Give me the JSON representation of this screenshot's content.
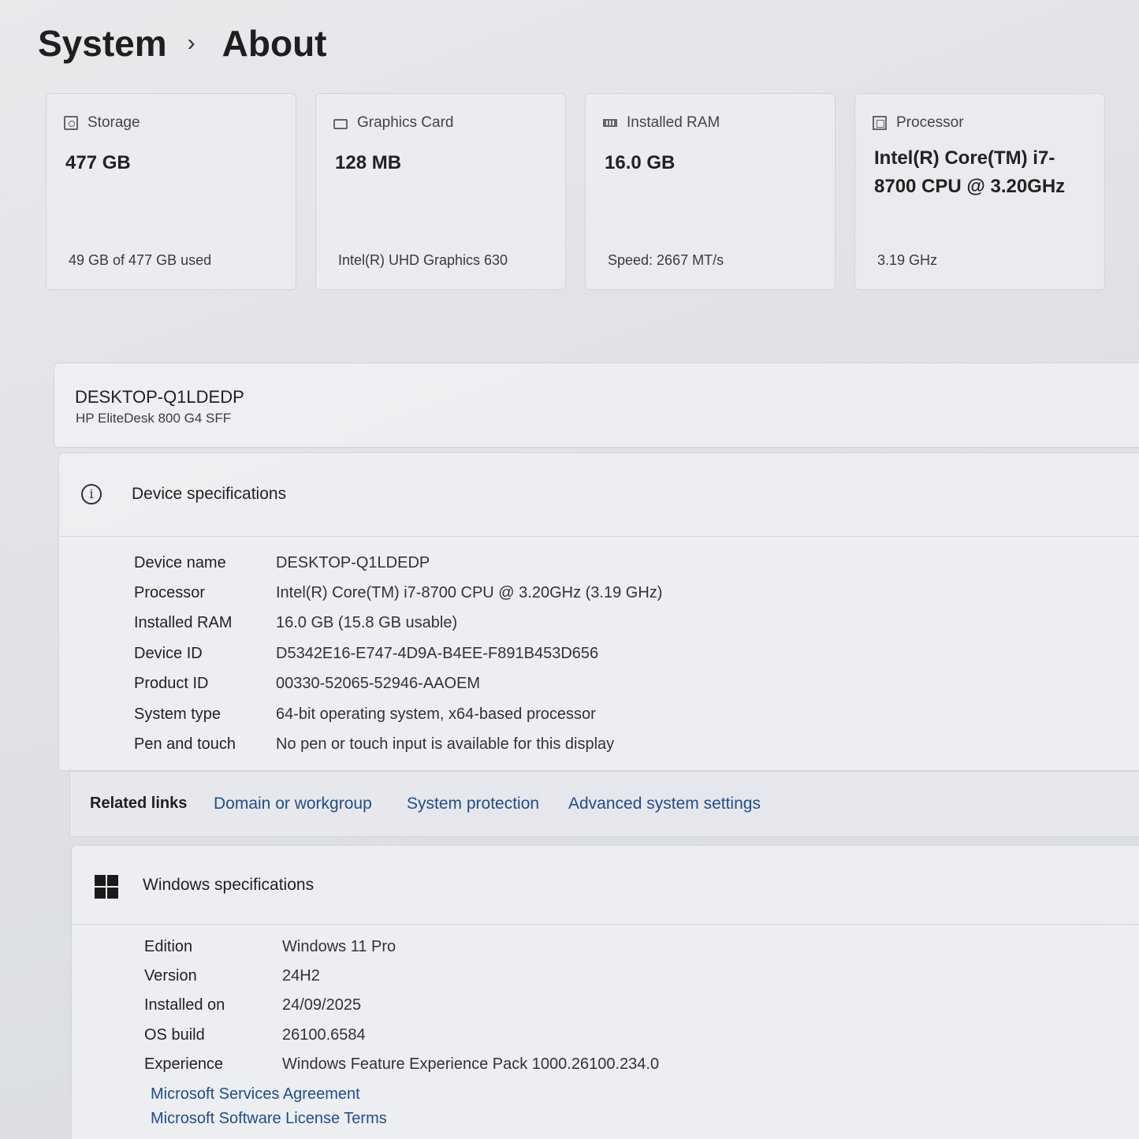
{
  "breadcrumb": {
    "parent": "System",
    "separator": "›",
    "current": "About"
  },
  "summary_cards": [
    {
      "icon": "storage-icon",
      "label": "Storage",
      "value": "477 GB",
      "detail": "49 GB of 477 GB used"
    },
    {
      "icon": "graphics-card-icon",
      "label": "Graphics Card",
      "value": "128 MB",
      "detail": "Intel(R) UHD Graphics 630"
    },
    {
      "icon": "ram-icon",
      "label": "Installed RAM",
      "value": "16.0 GB",
      "detail": "Speed: 2667 MT/s"
    },
    {
      "icon": "processor-icon",
      "label": "Processor",
      "value": "Intel(R) Core(TM) i7-8700 CPU @ 3.20GHz",
      "detail": "3.19 GHz"
    }
  ],
  "device": {
    "name": "DESKTOP-Q1LDEDP",
    "model": "HP EliteDesk 800 G4 SFF"
  },
  "device_specs": {
    "title": "Device specifications",
    "icon": "info-icon",
    "rows": [
      {
        "key": "Device name",
        "value": "DESKTOP-Q1LDEDP"
      },
      {
        "key": "Processor",
        "value": "Intel(R) Core(TM) i7-8700 CPU @ 3.20GHz (3.19 GHz)"
      },
      {
        "key": "Installed RAM",
        "value": "16.0 GB (15.8 GB usable)"
      },
      {
        "key": "Device ID",
        "value": "D5342E16-E747-4D9A-B4EE-F891B453D656"
      },
      {
        "key": "Product ID",
        "value": "00330-52065-52946-AAOEM"
      },
      {
        "key": "System type",
        "value": "64-bit operating system, x64-based processor"
      },
      {
        "key": "Pen and touch",
        "value": "No pen or touch input is available for this display"
      }
    ]
  },
  "related_links": {
    "label": "Related links",
    "links": [
      "Domain or workgroup",
      "System protection",
      "Advanced system settings"
    ]
  },
  "windows_specs": {
    "title": "Windows specifications",
    "icon": "windows-logo-icon",
    "rows": [
      {
        "key": "Edition",
        "value": "Windows 11 Pro"
      },
      {
        "key": "Version",
        "value": "24H2"
      },
      {
        "key": "Installed on",
        "value": "24/09/2025"
      },
      {
        "key": "OS build",
        "value": "26100.6584"
      },
      {
        "key": "Experience",
        "value": "Windows Feature Experience Pack 1000.26100.234.0"
      }
    ],
    "links": [
      "Microsoft Services Agreement",
      "Microsoft Software License Terms"
    ]
  },
  "colors": {
    "link": "#1f4e8a",
    "background": "#e2e4e8",
    "card": "#eeeef2"
  }
}
